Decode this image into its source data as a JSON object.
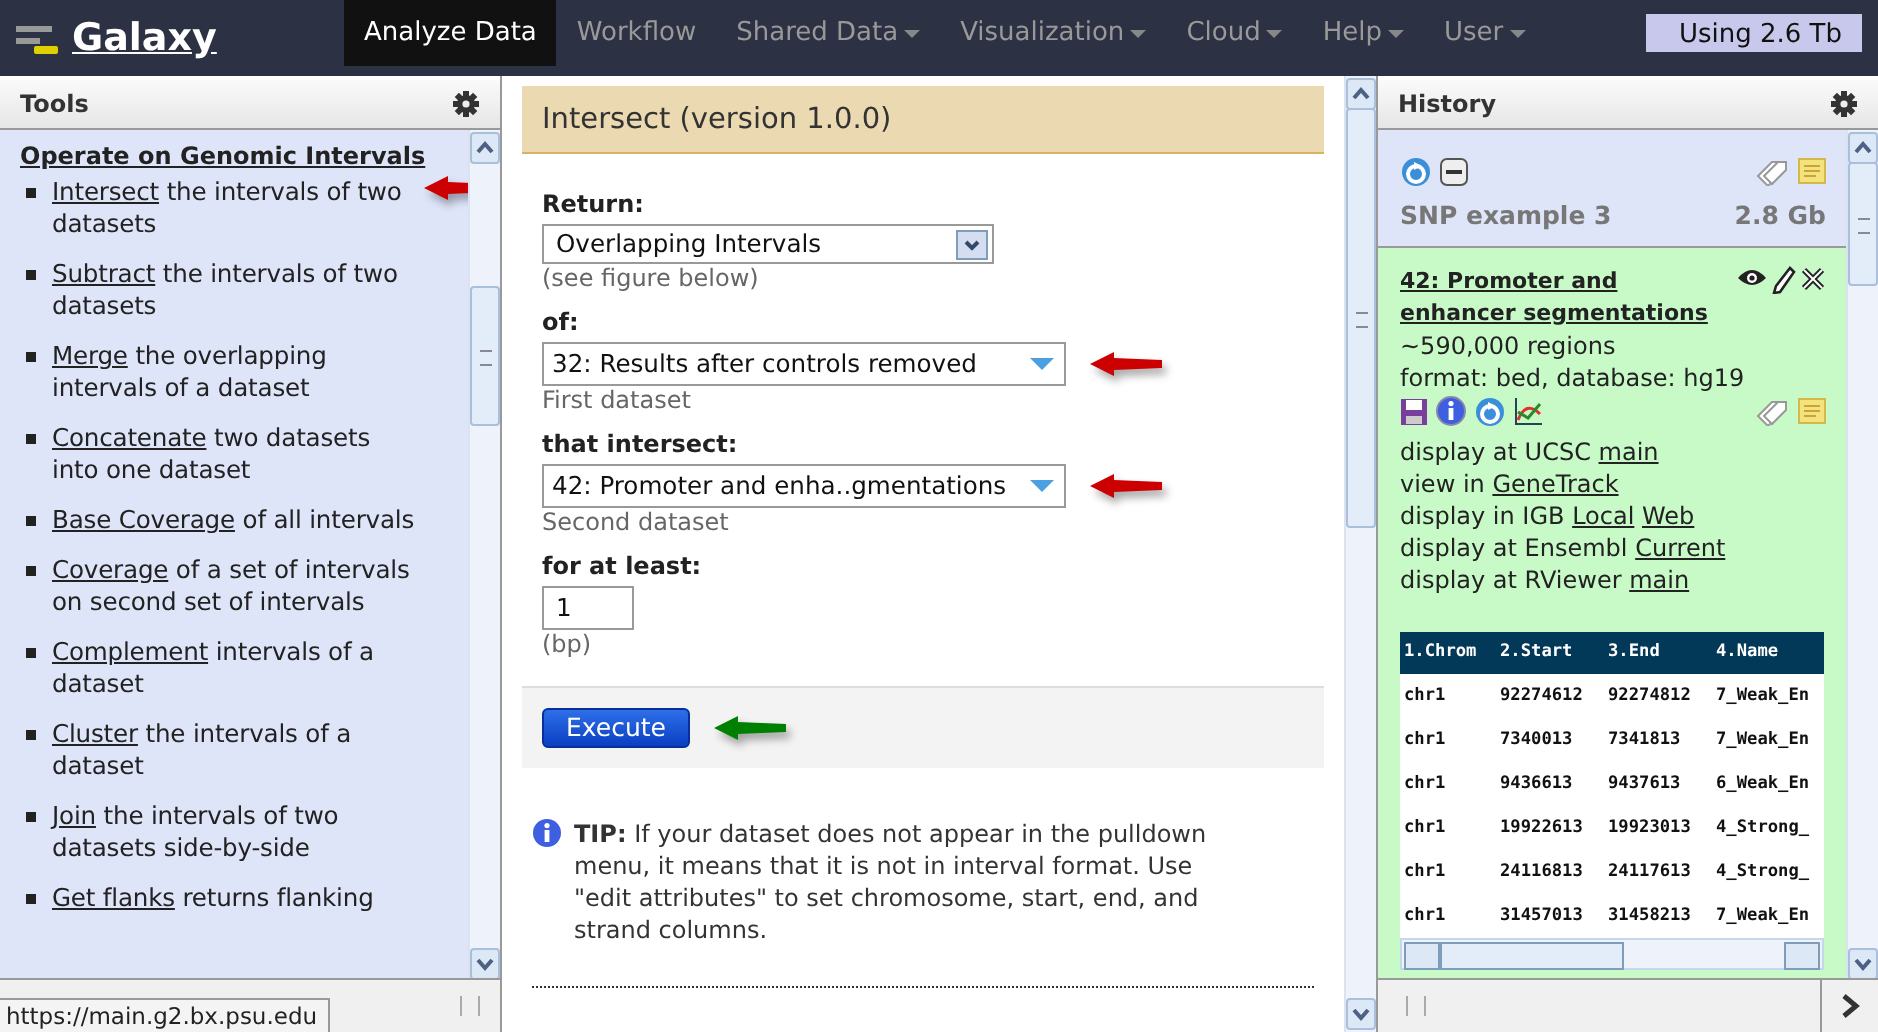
{
  "nav": {
    "logo": "Galaxy",
    "items": [
      {
        "label": "Analyze Data",
        "selected": true,
        "dropdown": false
      },
      {
        "label": "Workflow",
        "selected": false,
        "dropdown": false
      },
      {
        "label": "Shared Data",
        "selected": false,
        "dropdown": true
      },
      {
        "label": "Visualization",
        "selected": false,
        "dropdown": true
      },
      {
        "label": "Cloud",
        "selected": false,
        "dropdown": true
      },
      {
        "label": "Help",
        "selected": false,
        "dropdown": true
      },
      {
        "label": "User",
        "selected": false,
        "dropdown": true
      }
    ],
    "usage": "Using 2.6 Tb"
  },
  "tools": {
    "title": "Tools",
    "section": "Operate on Genomic Intervals",
    "items": [
      {
        "link": "Intersect",
        "text": " the intervals of two datasets",
        "marker": {
          "color": "#cc0000"
        }
      },
      {
        "link": "Subtract",
        "text": " the intervals of two datasets"
      },
      {
        "link": "Merge",
        "text": " the overlapping intervals of a dataset"
      },
      {
        "link": "Concatenate",
        "text": " two datasets into one dataset"
      },
      {
        "link": "Base Coverage",
        "text": " of all intervals"
      },
      {
        "link": "Coverage",
        "text": " of a set of intervals on second set of intervals"
      },
      {
        "link": "Complement",
        "text": " intervals of a dataset"
      },
      {
        "link": "Cluster",
        "text": " the intervals of a dataset"
      },
      {
        "link": "Join",
        "text": " the intervals of two datasets side-by-side"
      },
      {
        "link": "Get flanks",
        "text": " returns flanking"
      }
    ]
  },
  "status_url": "https://main.g2.bx.psu.edu",
  "form": {
    "title": "Intersect (version 1.0.0)",
    "fields": [
      {
        "kind": "select",
        "label": "Return:",
        "value": "Overlapping Intervals",
        "help": "(see figure below)"
      },
      {
        "kind": "combo",
        "label": "of:",
        "value": "32: Results after controls removed",
        "help": "First dataset",
        "marker": {
          "color": "#cc0000"
        }
      },
      {
        "kind": "combo",
        "label": "that intersect:",
        "value": "42: Promoter and enha..gmentations",
        "help": "Second dataset",
        "marker": {
          "color": "#cc0000"
        }
      },
      {
        "kind": "text",
        "label": "for at least:",
        "value": "1",
        "help": "(bp)"
      }
    ],
    "execute": {
      "label": "Execute",
      "marker": {
        "color": "#008000"
      }
    },
    "tip": "**TIP:** If your dataset does not appear in the pulldown menu, it means that it is not in interval format. Use \"edit attributes\" to set chromosome, start, end, and strand columns."
  },
  "history": {
    "title": "History",
    "name": "SNP example 3",
    "size": "2.8 Gb",
    "dataset": {
      "title": "42: Promoter and enhancer segmentations",
      "blurb": "~590,000 regions",
      "info": "format: bed, database: hg19",
      "displays": [
        {
          "text": "display at UCSC",
          "links": [
            "main"
          ]
        },
        {
          "text": "view in",
          "links": [
            "GeneTrack"
          ]
        },
        {
          "text": "display in IGB",
          "links": [
            "Local",
            "Web"
          ]
        },
        {
          "text": "display at Ensembl",
          "links": [
            "Current"
          ]
        },
        {
          "text": "display at RViewer",
          "links": [
            "main"
          ]
        }
      ],
      "table": {
        "columns": [
          "1.Chrom",
          "2.Start",
          "3.End",
          "4.Name"
        ],
        "rows": [
          [
            "chr1",
            "92274612",
            "92274812",
            "7_Weak_En"
          ],
          [
            "chr1",
            "7340013",
            "7341813",
            "7_Weak_En"
          ],
          [
            "chr1",
            "9436613",
            "9437613",
            "6_Weak_En"
          ],
          [
            "chr1",
            "19922613",
            "19923013",
            "4_Strong_"
          ],
          [
            "chr1",
            "24116813",
            "24117613",
            "4_Strong_"
          ],
          [
            "chr1",
            "31457013",
            "31458213",
            "7_Weak_En"
          ]
        ]
      }
    }
  }
}
